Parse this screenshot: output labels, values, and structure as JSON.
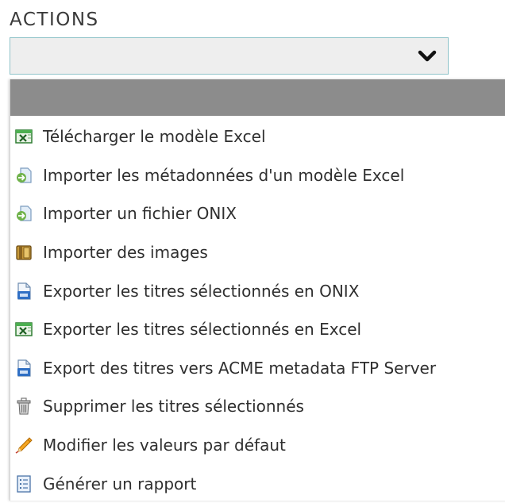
{
  "section_title": "ACTIONS",
  "select": {
    "value": "",
    "icon": "chevron-down-icon"
  },
  "menu": {
    "items": [
      {
        "label": "Télécharger le modèle Excel",
        "icon": "excel-icon"
      },
      {
        "label": "Importer les métadonnées d'un modèle Excel",
        "icon": "import-icon"
      },
      {
        "label": "Importer un fichier ONIX",
        "icon": "import-icon"
      },
      {
        "label": "Importer des images",
        "icon": "images-folder-icon"
      },
      {
        "label": "Exporter les titres sélectionnés en ONIX",
        "icon": "document-export-icon"
      },
      {
        "label": "Exporter les titres sélectionnés en Excel",
        "icon": "excel-icon"
      },
      {
        "label": "Export des titres vers  ACME metadata FTP Server",
        "icon": "document-export-icon"
      },
      {
        "label": "Supprimer les titres sélectionnés",
        "icon": "trash-icon"
      },
      {
        "label": "Modifier les valeurs par défaut",
        "icon": "pencil-icon"
      },
      {
        "label": "Générer un rapport",
        "icon": "report-icon"
      }
    ]
  },
  "colors": {
    "select_background": "#eeeeee",
    "select_border": "#8fc3c9",
    "dropdown_header": "#8c8c8c",
    "text": "#2f2f2f"
  }
}
